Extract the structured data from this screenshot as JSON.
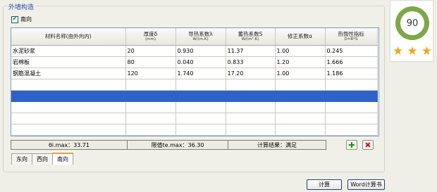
{
  "panel": {
    "title": "外墙构造"
  },
  "direction_checkbox": {
    "label": "南向",
    "checked": true,
    "check_glyph": "✔"
  },
  "table": {
    "headers": [
      {
        "label": "材料名称(由外向内)",
        "unit": ""
      },
      {
        "label": "厚度δ",
        "unit": "(mm)"
      },
      {
        "label": "导热系数λ",
        "unit": "W/(m.K)"
      },
      {
        "label": "蓄热系数S",
        "unit": "W/(m².K)"
      },
      {
        "label": "修正系数α",
        "unit": ""
      },
      {
        "label": "热惰性指标",
        "unit": "D=R*S"
      }
    ],
    "rows": [
      [
        "水泥砂浆",
        "20",
        "0.930",
        "11.37",
        "1.00",
        "0.245"
      ],
      [
        "岩棉板",
        "80",
        "0.040",
        "0.833",
        "1.20",
        "1.666"
      ],
      [
        "钢筋混凝土",
        "120",
        "1.740",
        "17.20",
        "1.00",
        "1.186"
      ],
      [
        "",
        "",
        "",
        "",
        "",
        ""
      ],
      [
        "",
        "",
        "",
        "",
        "",
        ""
      ],
      [
        "",
        "",
        "",
        "",
        "",
        ""
      ],
      [
        "",
        "",
        "",
        "",
        "",
        ""
      ],
      [
        "",
        "",
        "",
        "",
        "",
        ""
      ]
    ],
    "selected_row_index": 4,
    "selected_color": "#2f62c9"
  },
  "summary": {
    "theta": "θi.max：33.71",
    "limit": "限值te.max：36.30",
    "result": "计算结果：满足"
  },
  "icons": {
    "add": "add-icon",
    "delete": "delete-icon"
  },
  "tabs": [
    "东向",
    "西向",
    "南向"
  ],
  "active_tab": "南向",
  "buttons": {
    "calc": "计算",
    "word": "Word计算书"
  },
  "score": {
    "value": "90",
    "stars": 3,
    "ring_color": "#7fa64a",
    "star_color": "#f2a61a"
  }
}
